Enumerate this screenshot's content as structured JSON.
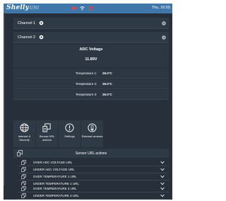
{
  "app": {
    "logo": "Shelly",
    "logo_sub": "UNI",
    "time": "Thu, 16:55"
  },
  "channels": [
    {
      "label": "Channel 1"
    },
    {
      "label": "Channel 2"
    }
  ],
  "adc": {
    "title": "ADC Voltage",
    "value": "11.89V"
  },
  "temperatures": [
    {
      "label": "Temperature 1:",
      "value": "26.0°C"
    },
    {
      "label": "Temperature 2:",
      "value": "26.0°C"
    },
    {
      "label": "Temperature 3:",
      "value": "26.0°C"
    }
  ],
  "tiles": [
    {
      "icon": "globe-icon",
      "label": "Internet & Security"
    },
    {
      "icon": "sensor-url-icon",
      "label": "Sensor URL actions"
    },
    {
      "icon": "settings-icon",
      "label": "Settings"
    },
    {
      "icon": "external-sensors-icon",
      "label": "External sensors"
    }
  ],
  "sensor_actions": {
    "title": "Sensor URL actions",
    "items": [
      "OVER ADC VOLTAGE URL",
      "UNDER ADC VOLTAGE URL",
      "OVER TEMPERATURE 1 URL",
      "UNDER TEMPERATURE 1 URL",
      "OVER TEMPERATURE 2 URL",
      "UNDER TEMPERATURE 2 URL",
      "OVER TEMPERATURE 3 URL",
      "UNDER TEMPERATURE 3 URL"
    ]
  },
  "colors": {
    "header": "#3f77ab",
    "background": "#262f3a",
    "panel": "#2f3a47",
    "status_red": "#e0474c"
  }
}
